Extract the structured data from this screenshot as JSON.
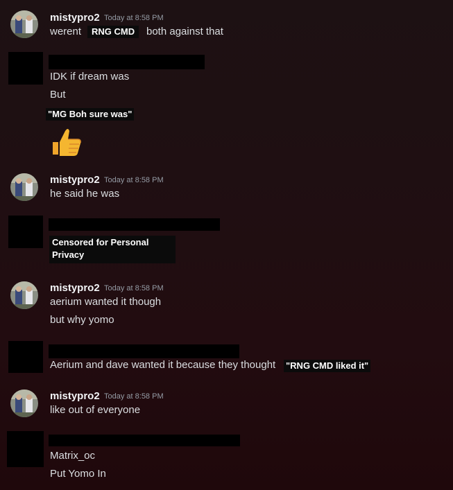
{
  "messages": [
    {
      "author": "mistypro2",
      "timestamp": "Today at 8:58 PM",
      "lines": [
        "werent",
        "both against that"
      ],
      "overlay": "RNG CMD"
    },
    {
      "lines": [
        "IDK if dream was",
        "But"
      ],
      "overlay": "\"MG Boh sure was\"",
      "reaction_icon": "thumbs-up-icon"
    },
    {
      "author": "mistypro2",
      "timestamp": "Today at 8:58 PM",
      "lines": [
        "he said he was"
      ]
    },
    {
      "overlay_lines": [
        "Censored for Personal",
        "Privacy"
      ]
    },
    {
      "author": "mistypro2",
      "timestamp": "Today at 8:58 PM",
      "lines": [
        "aerium wanted it though",
        "but why yomo"
      ]
    },
    {
      "lines": [
        "Aerium and dave wanted it because they thought"
      ],
      "overlay": "\"RNG CMD liked it\""
    },
    {
      "author": "mistypro2",
      "timestamp": "Today at 8:58 PM",
      "lines": [
        "like out of everyone"
      ]
    },
    {
      "lines": [
        "Matrix_oc",
        "Put Yomo In"
      ]
    }
  ],
  "colors": {
    "username": "#f2f3f5",
    "timestamp": "#949ba4",
    "message_text": "#dbdee1",
    "censor_box": "#000000"
  }
}
